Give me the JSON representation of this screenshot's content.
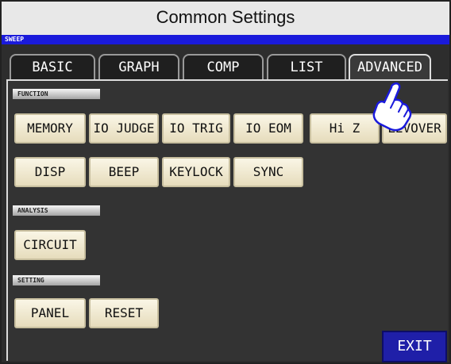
{
  "header": {
    "title": "Common Settings",
    "mode": "SWEEP"
  },
  "tabs": [
    {
      "label": "BASIC",
      "active": false
    },
    {
      "label": "GRAPH",
      "active": false
    },
    {
      "label": "COMP",
      "active": false
    },
    {
      "label": "LIST",
      "active": false
    },
    {
      "label": "ADVANCED",
      "active": true
    }
  ],
  "sections": {
    "function": {
      "label": "FUNCTION",
      "buttons": [
        "MEMORY",
        "IO JUDGE",
        "IO TRIG",
        "IO EOM",
        "Hi Z",
        "LEVOVER",
        "DISP",
        "BEEP",
        "KEYLOCK",
        "SYNC"
      ]
    },
    "analysis": {
      "label": "ANALYSIS",
      "buttons": [
        "CIRCUIT"
      ]
    },
    "setting": {
      "label": "SETTING",
      "buttons": [
        "PANEL",
        "RESET"
      ]
    }
  },
  "footer": {
    "exit_label": "EXIT"
  },
  "colors": {
    "mode_bar": "#1a1adb",
    "button_face": "#f0e9cf",
    "exit_button": "#1f1fa8",
    "background": "#2d2d2d"
  },
  "icons": {
    "pointer": "pointing-hand-icon"
  }
}
